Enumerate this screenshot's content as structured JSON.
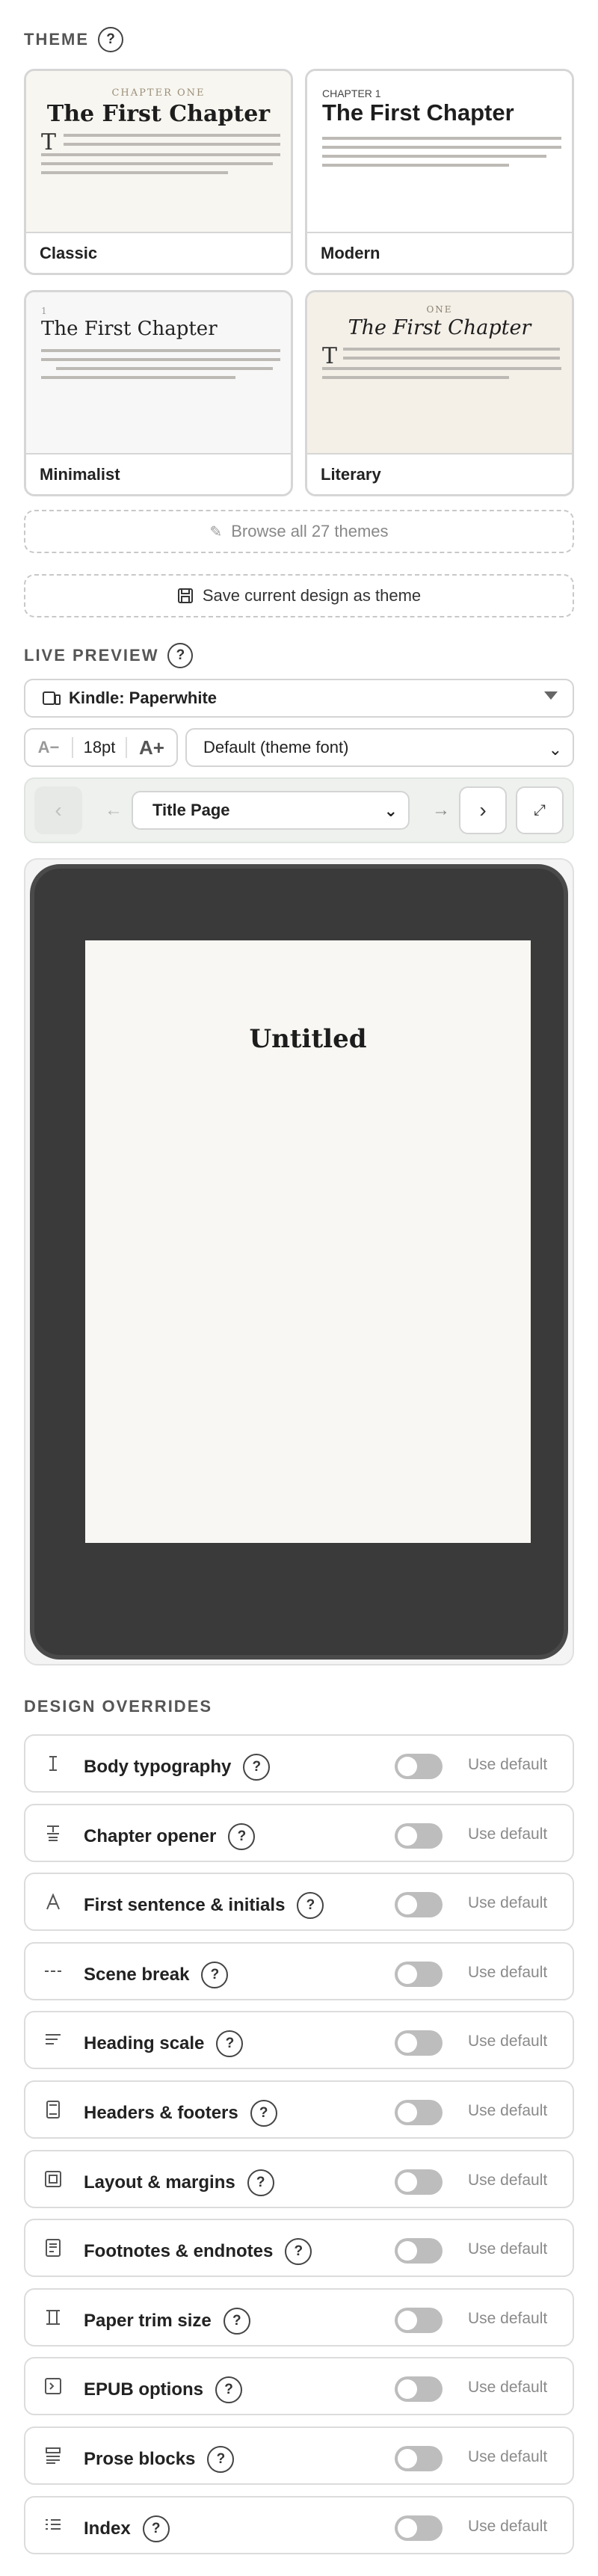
{
  "theme": {
    "heading": "THEME",
    "help": "?",
    "cards": [
      {
        "label": "Classic",
        "kicker": "CHAPTER ONE",
        "title": "The First Chapter",
        "dropcap": "T"
      },
      {
        "label": "Modern",
        "kicker": "CHAPTER 1",
        "title": "The First Chapter"
      },
      {
        "label": "Minimalist",
        "kicker": "1",
        "title": "The First Chapter"
      },
      {
        "label": "Literary",
        "kicker": "ONE",
        "title": "The First Chapter",
        "dropcap": "T"
      }
    ],
    "browse_label": "Browse all 27 themes",
    "save_label": "Save current design as theme"
  },
  "preview": {
    "heading": "LIVE PREVIEW",
    "help": "?",
    "device": "Kindle: Paperwhite",
    "font_decrease": "A−",
    "font_size": "18pt",
    "font_increase": "A+",
    "font_select": "Default (theme font)",
    "page_select": "Title Page",
    "book_title": "Untitled"
  },
  "overrides": {
    "heading": "DESIGN OVERRIDES",
    "default_label": "Use default",
    "items": [
      {
        "label": "Body typography",
        "icon": "text-cursor-icon"
      },
      {
        "label": "Chapter opener",
        "icon": "chapter-opener-icon"
      },
      {
        "label": "First sentence & initials",
        "icon": "letter-a-icon"
      },
      {
        "label": "Scene break",
        "icon": "scene-break-icon"
      },
      {
        "label": "Heading scale",
        "icon": "heading-scale-icon"
      },
      {
        "label": "Headers & footers",
        "icon": "headers-footers-icon"
      },
      {
        "label": "Layout & margins",
        "icon": "layout-margins-icon"
      },
      {
        "label": "Footnotes & endnotes",
        "icon": "footnotes-icon"
      },
      {
        "label": "Paper trim size",
        "icon": "trim-size-icon"
      },
      {
        "label": "EPUB options",
        "icon": "epub-icon"
      },
      {
        "label": "Prose blocks",
        "icon": "prose-blocks-icon"
      },
      {
        "label": "Index",
        "icon": "index-icon"
      }
    ]
  },
  "colors": {
    "classic_bg": "#f8f6f0",
    "literary_bg": "#f4f0e8",
    "device_frame": "#3a3a3a",
    "toggle_off": "#bdbdbd"
  }
}
